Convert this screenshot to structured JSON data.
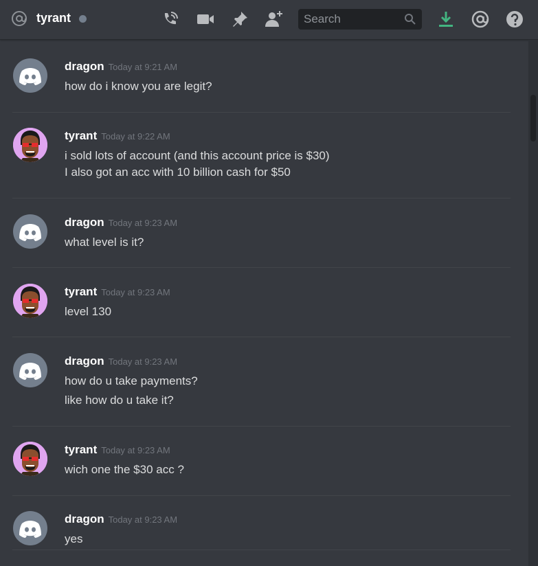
{
  "header": {
    "channel_name": "tyrant",
    "search_placeholder": "Search",
    "icons": [
      "at-icon",
      "phone-call-icon",
      "video-icon",
      "pin-icon",
      "add-friend-icon",
      "search-icon",
      "download-icon",
      "mentions-icon",
      "help-icon"
    ],
    "accent_download": "#43b581"
  },
  "messages": [
    {
      "author": "dragon",
      "timestamp": "Today at 9:21 AM",
      "lines": [
        "how do i know you are legit?"
      ]
    },
    {
      "author": "tyrant",
      "timestamp": "Today at 9:22 AM",
      "lines": [
        "i sold lots of account (and this account price is $30)",
        "I also got an acc with 10 billion cash for $50"
      ]
    },
    {
      "author": "dragon",
      "timestamp": "Today at 9:23 AM",
      "lines": [
        "what level is it?"
      ]
    },
    {
      "author": "tyrant",
      "timestamp": "Today at 9:23 AM",
      "lines": [
        "level 130"
      ]
    },
    {
      "author": "dragon",
      "timestamp": "Today at 9:23 AM",
      "lines": [
        "how do u take payments?",
        "like how do u take it?"
      ]
    },
    {
      "author": "tyrant",
      "timestamp": "Today at 9:23 AM",
      "lines": [
        "wich one the $30 acc ?"
      ]
    },
    {
      "author": "dragon",
      "timestamp": "Today at 9:23 AM",
      "lines": [
        "yes"
      ]
    }
  ]
}
